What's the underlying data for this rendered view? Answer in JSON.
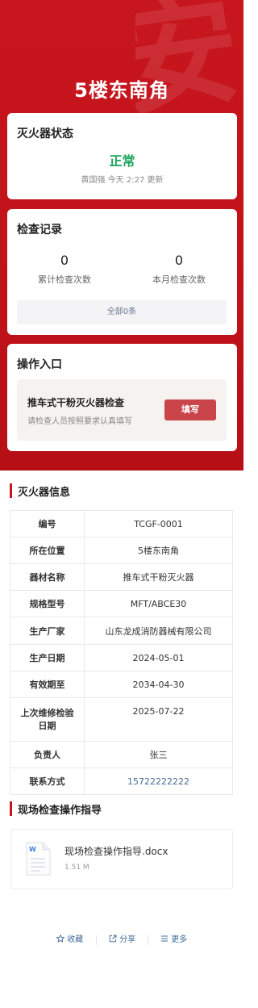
{
  "header": {
    "title": "5楼东南角",
    "watermark_glyph": "安",
    "background_color": "#c8161e"
  },
  "status_card": {
    "title": "灭火器状态",
    "status": "正常",
    "status_color": "#1fa55a",
    "updated_by": "黄国强",
    "updated_time": "今天 2:27",
    "updated_suffix": "更新"
  },
  "records_card": {
    "title": "检查记录",
    "total_count": "0",
    "total_label": "累计检查次数",
    "month_count": "0",
    "month_label": "本月检查次数",
    "all_link": "全部0条"
  },
  "operation_card": {
    "title": "操作入口",
    "item_name": "推车式干粉灭火器检查",
    "item_desc": "请检查人员按照要求认真填写",
    "fill_button": "填写"
  },
  "info_section": {
    "title": "灭火器信息",
    "rows": [
      {
        "key": "编号",
        "value": "TCGF-0001"
      },
      {
        "key": "所在位置",
        "value": "5楼东南角"
      },
      {
        "key": "器材名称",
        "value": "推车式干粉灭火器"
      },
      {
        "key": "规格型号",
        "value": "MFT/ABCE30"
      },
      {
        "key": "生产厂家",
        "value": "山东龙成消防器械有限公司"
      },
      {
        "key": "生产日期",
        "value": "2024-05-01"
      },
      {
        "key": "有效期至",
        "value": "2034-04-30"
      },
      {
        "key": "上次维修检验日期",
        "value": "2025-07-22"
      },
      {
        "key": "负责人",
        "value": "张三"
      },
      {
        "key": "联系方式",
        "value": "15722222222"
      }
    ]
  },
  "guide_section": {
    "title": "现场检查操作指导",
    "file_name": "现场检查操作指导.docx",
    "file_size": "1.51 M",
    "file_icon": "word-document-icon"
  },
  "footer": {
    "favorite": "收藏",
    "favorite_icon": "star-icon",
    "share": "分享",
    "share_icon": "share-icon",
    "more": "更多",
    "more_icon": "menu-icon",
    "link_color": "#3f6b99"
  }
}
